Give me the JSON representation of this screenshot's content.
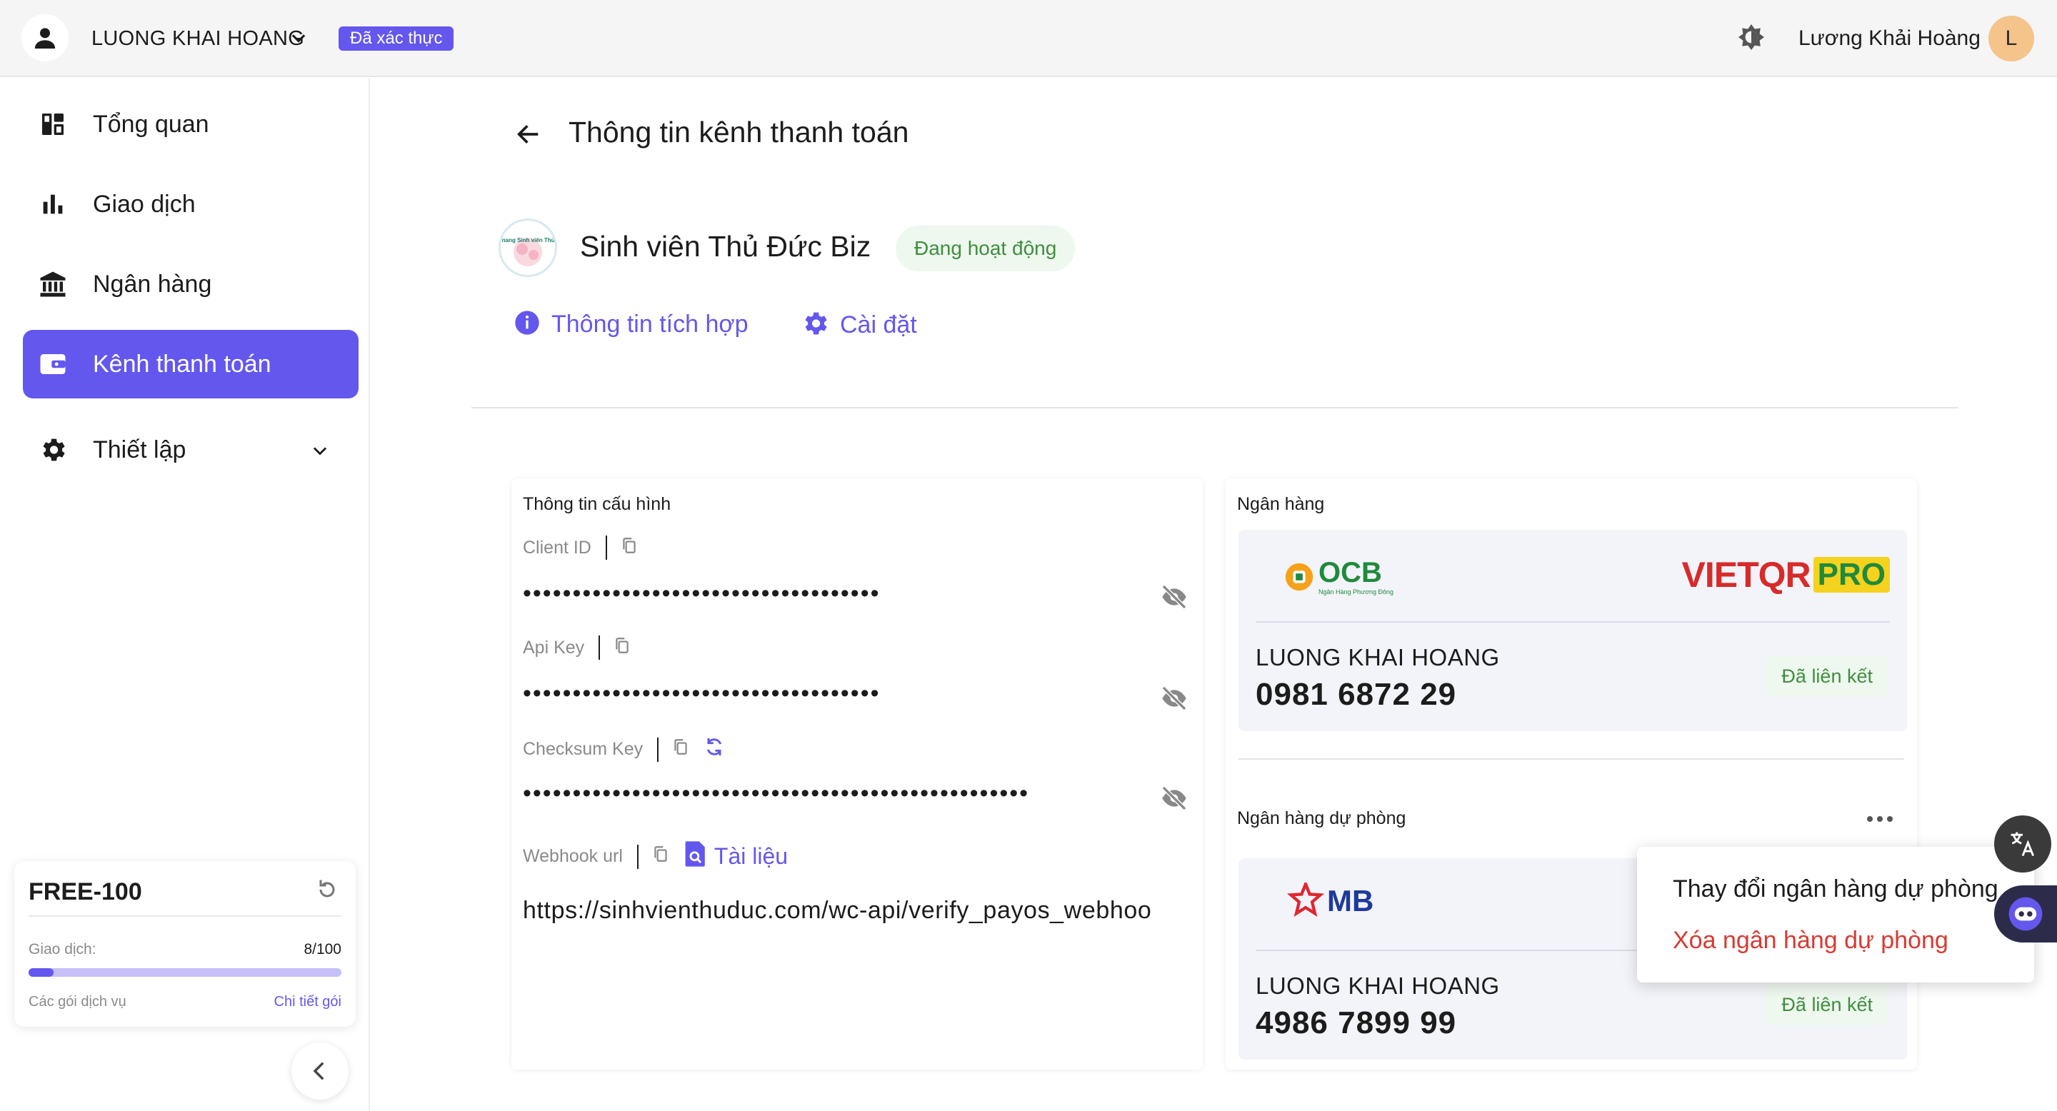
{
  "topbar": {
    "username": "LUONG KHAI HOANG",
    "verified": "Đã xác thực",
    "full_name": "Lương Khải Hoàng",
    "initial": "L"
  },
  "sidebar": {
    "items": [
      {
        "label": "Tổng quan",
        "icon": "dashboard-icon"
      },
      {
        "label": "Giao dịch",
        "icon": "bar-chart-icon"
      },
      {
        "label": "Ngân hàng",
        "icon": "bank-icon"
      },
      {
        "label": "Kênh thanh toán",
        "icon": "wallet-icon",
        "active": true
      },
      {
        "label": "Thiết lập",
        "icon": "gear-icon"
      }
    ]
  },
  "plan": {
    "name": "FREE-100",
    "transactions_label": "Giao dịch:",
    "transactions_count": "8/100",
    "usage_fraction": 0.08,
    "services_label": "Các gói dịch vụ",
    "details_link": "Chi tiết gói"
  },
  "page": {
    "title": "Thông tin kênh thanh toán",
    "channel_name": "Sinh viên Thủ Đức Biz",
    "channel_logo_text": "Cẩm nang Sinh viên Thủ Đức",
    "status": "Đang hoạt động",
    "tabs": {
      "info": "Thông tin tích hợp",
      "settings": "Cài đặt"
    }
  },
  "config": {
    "heading": "Thông tin cấu hình",
    "client_id_label": "Client ID",
    "client_id_value": "••••••••••••••••••••••••••••••••••••",
    "api_key_label": "Api Key",
    "api_key_value": "••••••••••••••••••••••••••••••••••••",
    "checksum_label": "Checksum Key",
    "checksum_value": "•••••••••••••••••••••••••••••••••••••••••••••••••••",
    "webhook_label": "Webhook url",
    "docs_link": "Tài liệu",
    "webhook_value": "https://sinhvienthuduc.com/wc-api/verify_payos_webhoo"
  },
  "banks": {
    "heading": "Ngân hàng",
    "primary": {
      "bank_logo": "OCB",
      "bank_subtitle": "Ngân Hàng Phương Đông",
      "partner_logo_a": "VIETQR",
      "partner_logo_b": "PRO",
      "account_name": "LUONG KHAI HOANG",
      "account_number": "0981 6872 29",
      "status": "Đã liên kết"
    },
    "backup_heading": "Ngân hàng dự phòng",
    "backup": {
      "bank_logo": "MB",
      "account_name": "LUONG KHAI HOANG",
      "account_number": "4986 7899 99",
      "status": "Đã liên kết"
    }
  },
  "popup": {
    "change": "Thay đổi ngân hàng dự phòng",
    "delete": "Xóa ngân hàng dự phòng"
  },
  "colors": {
    "accent": "#6457ee",
    "success_text": "#3f8e3f",
    "success_bg": "#eef8ee",
    "danger": "#d93a32",
    "vietqr_red": "#d72b2b",
    "vietqr_blue": "#1d3a8a",
    "pro_yellow": "#f5d21e",
    "ocb_green": "#1f8a3c",
    "ocb_orange": "#f5a21a",
    "mb_red": "#e0262f",
    "mb_blue": "#1e3a9a"
  }
}
